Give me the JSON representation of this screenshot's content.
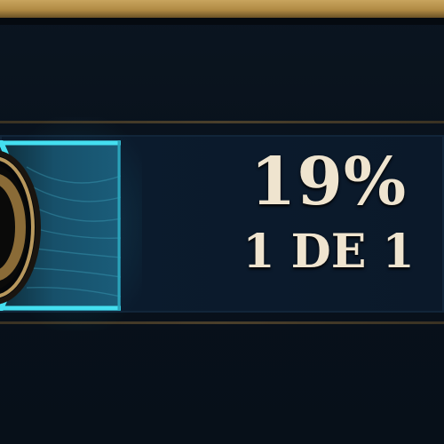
{
  "progress": {
    "percent_text": "19%",
    "percent_value": 19,
    "count_text": "1 DE 1"
  },
  "colors": {
    "gold_border": "#c8a45e",
    "progress_cyan": "#35d4e6",
    "text": "#efe4cf"
  },
  "icons": {
    "emblem": "gold-ring-emblem-icon"
  }
}
